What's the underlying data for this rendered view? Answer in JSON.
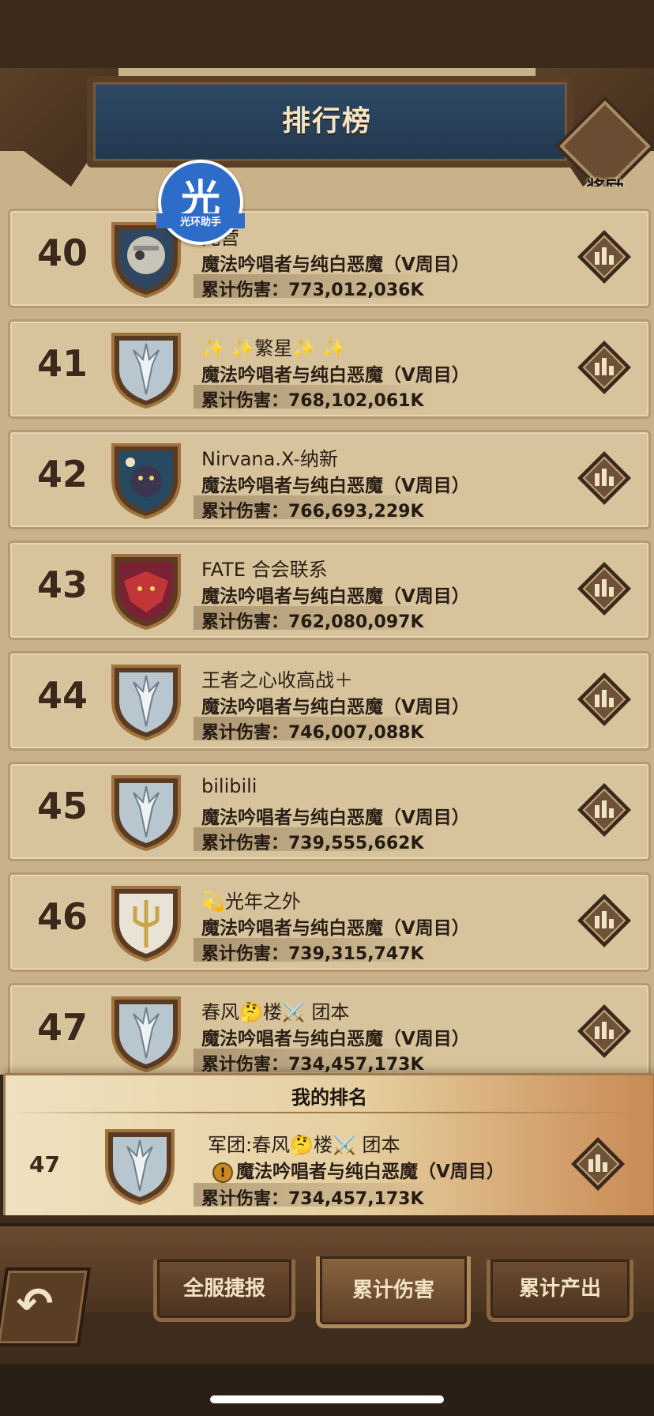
{
  "header": {
    "title": "排行榜",
    "reward_label": "奖励"
  },
  "overlay": {
    "glyph": "光",
    "label": "光环助手"
  },
  "rows": [
    {
      "rank": "40",
      "name": "兆营",
      "boss": "魔法吟唱者与纯白恶魔（V周目）",
      "damage": "累计伤害：773,012,036K",
      "emblem": "old-knight-emblem"
    },
    {
      "rank": "41",
      "name": "✨ ✨繁星✨ ✨",
      "boss": "魔法吟唱者与纯白恶魔（V周目）",
      "damage": "累计伤害：768,102,061K",
      "emblem": "silver-trident-emblem"
    },
    {
      "rank": "42",
      "name": "Nirvana.X-纳新",
      "boss": "魔法吟唱者与纯白恶魔（V周目）",
      "damage": "累计伤害：766,693,229K",
      "emblem": "night-creature-emblem"
    },
    {
      "rank": "43",
      "name": "FATE 合会联系",
      "boss": "魔法吟唱者与纯白恶魔（V周目）",
      "damage": "累计伤害：762,080,097K",
      "emblem": "red-dragon-emblem"
    },
    {
      "rank": "44",
      "name": "王者之心收高战＋",
      "boss": "魔法吟唱者与纯白恶魔（V周目）",
      "damage": "累计伤害：746,007,088K",
      "emblem": "silver-trident-emblem"
    },
    {
      "rank": "45",
      "name": "bilibili",
      "boss": "魔法吟唱者与纯白恶魔（V周目）",
      "damage": "累计伤害：739,555,662K",
      "emblem": "silver-trident-emblem"
    },
    {
      "rank": "46",
      "name": "💫光年之外",
      "boss": "魔法吟唱者与纯白恶魔（V周目）",
      "damage": "累计伤害：739,315,747K",
      "emblem": "golden-trident-emblem"
    },
    {
      "rank": "47",
      "name": "春风🤔楼⚔️ 团本",
      "boss": "魔法吟唱者与纯白恶魔（V周目）",
      "damage": "累计伤害：734,457,173K",
      "emblem": "silver-trident-emblem"
    }
  ],
  "my_rank": {
    "title": "我的排名",
    "rank": "47",
    "name": "军团:春风🤔楼⚔️ 团本",
    "alert": "!",
    "boss": "魔法吟唱者与纯白恶魔（V周目）",
    "damage": "累计伤害：734,457,173K"
  },
  "tabs": [
    {
      "label": "全服捷报",
      "active": false
    },
    {
      "label": "累计伤害",
      "active": true
    },
    {
      "label": "累计产出",
      "active": false
    }
  ],
  "back_label": "↶",
  "colors": {
    "parchment": "#d8c49c",
    "dark_wood": "#3e2c1c",
    "header_blue": "#2f4a64",
    "text_dark": "#2a1f16",
    "accent_orange": "#c98a54"
  }
}
